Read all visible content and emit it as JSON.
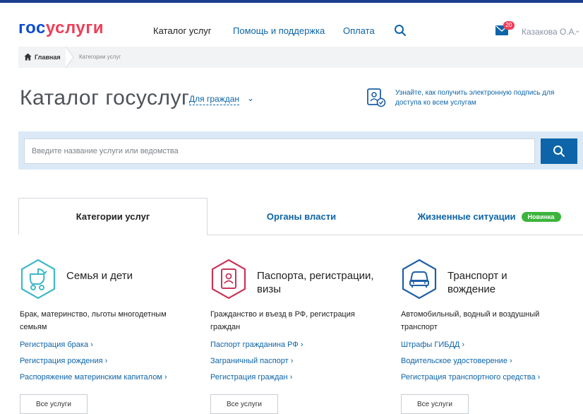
{
  "header": {
    "logo_part1": "гос",
    "logo_part2": "услуги",
    "nav": {
      "catalog": "Каталог услуг",
      "help": "Помощь и поддержка",
      "payment": "Оплата"
    },
    "notifications_count": "20",
    "user_name": "Казакова О.А."
  },
  "breadcrumb": {
    "home": "Главная",
    "current": "Категории услуг"
  },
  "title_row": {
    "title": "Каталог госуслуг",
    "audience": "Для граждан",
    "signature_link": "Узнайте, как получить электронную подпись для доступа ко всем услугам"
  },
  "search": {
    "placeholder": "Введите название услуги или ведомства"
  },
  "tabs": {
    "categories": "Категории услуг",
    "authorities": "Органы власти",
    "life_situations": "Жизненные ситуации",
    "new_badge": "Новинка"
  },
  "categories": [
    {
      "title": "Семья и дети",
      "description": "Брак, материнство, льготы многодетным семьям",
      "links": [
        "Регистрация брака",
        "Регистрация рождения",
        "Распоряжение материнским капиталом"
      ],
      "all_button": "Все услуги",
      "icon": "baby-carriage-icon",
      "color": "#3fb8c9"
    },
    {
      "title": "Паспорта, регистрации, визы",
      "description": "Гражданство и въезд в РФ, регистрация граждан",
      "links": [
        "Паспорт гражданина РФ",
        "Заграничный паспорт",
        "Регистрация граждан"
      ],
      "all_button": "Все услуги",
      "icon": "passport-icon",
      "color": "#c8365a"
    },
    {
      "title": "Транспорт и вождение",
      "description": "Автомобильный, водный и воздушный транспорт",
      "links": [
        "Штрафы ГИБДД",
        "Водительское удостоверение",
        "Регистрация транспортного средства"
      ],
      "all_button": "Все услуги",
      "icon": "car-icon",
      "color": "#1f5fa6"
    }
  ],
  "colors": {
    "brand_blue": "#0d4cd3",
    "brand_red": "#ee3f58",
    "link": "#0d64a8",
    "search_band": "#dbe9f6",
    "badge_green": "#3cb43c"
  }
}
